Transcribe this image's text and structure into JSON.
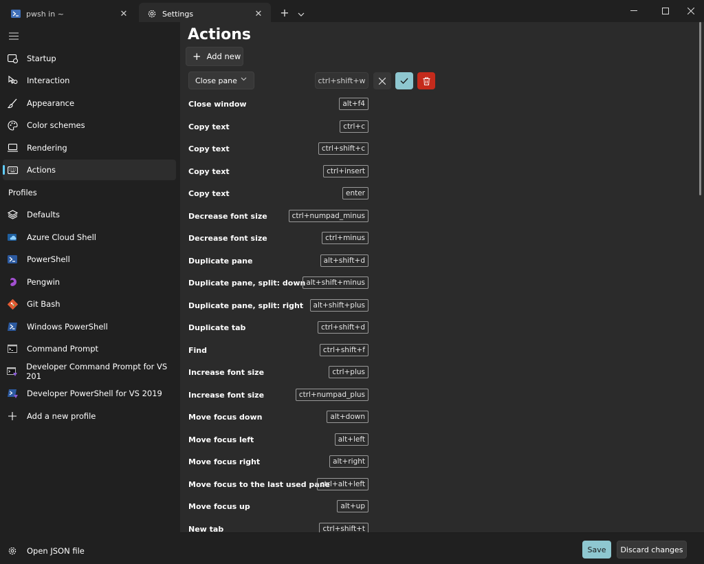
{
  "tabs": [
    {
      "label": "pwsh in ~"
    },
    {
      "label": "Settings"
    }
  ],
  "window": {
    "new_tab": "+",
    "dropdown": "⌄"
  },
  "sidebar": {
    "items": [
      {
        "label": "Startup",
        "icon": "startup-icon"
      },
      {
        "label": "Interaction",
        "icon": "interaction-icon"
      },
      {
        "label": "Appearance",
        "icon": "brush-icon"
      },
      {
        "label": "Color schemes",
        "icon": "palette-icon"
      },
      {
        "label": "Rendering",
        "icon": "monitor-icon"
      },
      {
        "label": "Actions",
        "icon": "keyboard-icon",
        "selected": true
      }
    ],
    "profiles_header": "Profiles",
    "profiles": [
      {
        "label": "Defaults",
        "icon": "layers-icon"
      },
      {
        "label": "Azure Cloud Shell",
        "icon": "azure-icon"
      },
      {
        "label": "PowerShell",
        "icon": "powershell-icon"
      },
      {
        "label": "Pengwin",
        "icon": "pengwin-icon"
      },
      {
        "label": "Git Bash",
        "icon": "git-icon"
      },
      {
        "label": "Windows PowerShell",
        "icon": "powershell-icon"
      },
      {
        "label": "Command Prompt",
        "icon": "cmd-icon"
      },
      {
        "label": "Developer Command Prompt for VS 201",
        "icon": "vs-cmd-icon"
      },
      {
        "label": "Developer PowerShell for VS 2019",
        "icon": "vs-powershell-icon"
      },
      {
        "label": "Add a new profile",
        "icon": "plus-icon"
      }
    ],
    "open_json": "Open JSON file"
  },
  "main": {
    "title": "Actions",
    "add_new": "Add new",
    "edit": {
      "action": "Close pane",
      "keys": "ctrl+shift+w"
    },
    "actions": [
      {
        "name": "Close window",
        "keys": "alt+f4"
      },
      {
        "name": "Copy text",
        "keys": "ctrl+c"
      },
      {
        "name": "Copy text",
        "keys": "ctrl+shift+c"
      },
      {
        "name": "Copy text",
        "keys": "ctrl+insert"
      },
      {
        "name": "Copy text",
        "keys": "enter"
      },
      {
        "name": "Decrease font size",
        "keys": "ctrl+numpad_minus"
      },
      {
        "name": "Decrease font size",
        "keys": "ctrl+minus"
      },
      {
        "name": "Duplicate pane",
        "keys": "alt+shift+d"
      },
      {
        "name": "Duplicate pane, split: down",
        "keys": "alt+shift+minus"
      },
      {
        "name": "Duplicate pane, split: right",
        "keys": "alt+shift+plus"
      },
      {
        "name": "Duplicate tab",
        "keys": "ctrl+shift+d"
      },
      {
        "name": "Find",
        "keys": "ctrl+shift+f"
      },
      {
        "name": "Increase font size",
        "keys": "ctrl+plus"
      },
      {
        "name": "Increase font size",
        "keys": "ctrl+numpad_plus"
      },
      {
        "name": "Move focus down",
        "keys": "alt+down"
      },
      {
        "name": "Move focus left",
        "keys": "alt+left"
      },
      {
        "name": "Move focus right",
        "keys": "alt+right"
      },
      {
        "name": "Move focus to the last used pane",
        "keys": "ctrl+alt+left"
      },
      {
        "name": "Move focus up",
        "keys": "alt+up"
      },
      {
        "name": "New tab",
        "keys": "ctrl+shift+t"
      }
    ]
  },
  "footer": {
    "save": "Save",
    "discard": "Discard changes"
  },
  "colors": {
    "accent": "#60cdff",
    "save": "#8ec7d0",
    "delete": "#c42b1c"
  }
}
